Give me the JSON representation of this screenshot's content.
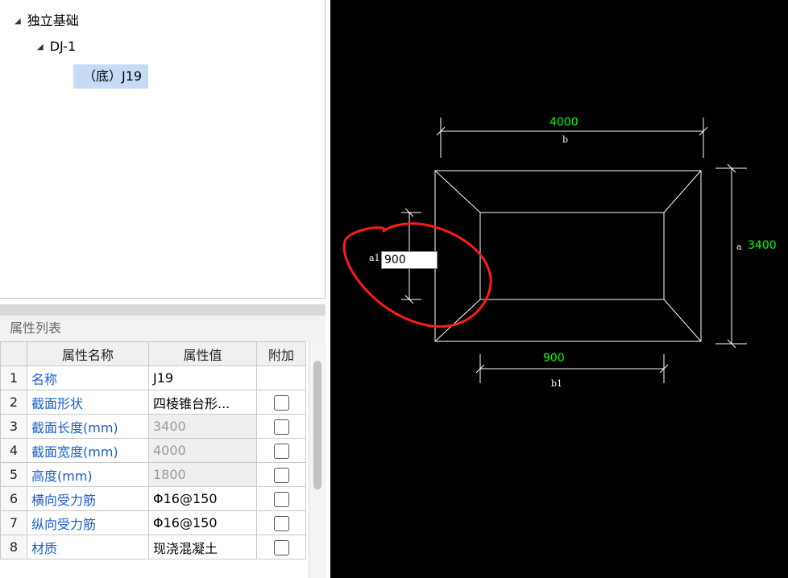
{
  "tree": {
    "root": "独立基础",
    "child": "DJ-1",
    "leaf": "（底）J19"
  },
  "properties": {
    "title": "属性列表",
    "headers": [
      "",
      "属性名称",
      "属性值",
      "附加"
    ],
    "rows": [
      {
        "num": "1",
        "name": "名称",
        "value": "J19",
        "disabled": false,
        "checkbox": false
      },
      {
        "num": "2",
        "name": "截面形状",
        "value": "四棱锥台形...",
        "disabled": false,
        "checkbox": true
      },
      {
        "num": "3",
        "name": "截面长度(mm)",
        "value": "3400",
        "disabled": true,
        "checkbox": true
      },
      {
        "num": "4",
        "name": "截面宽度(mm)",
        "value": "4000",
        "disabled": true,
        "checkbox": true
      },
      {
        "num": "5",
        "name": "高度(mm)",
        "value": "1800",
        "disabled": true,
        "checkbox": true
      },
      {
        "num": "6",
        "name": "横向受力筋",
        "value": "Φ16@150",
        "disabled": false,
        "checkbox": true
      },
      {
        "num": "7",
        "name": "纵向受力筋",
        "value": "Φ16@150",
        "disabled": false,
        "checkbox": true
      },
      {
        "num": "8",
        "name": "材质",
        "value": "现浇混凝土",
        "disabled": false,
        "checkbox": true
      }
    ]
  },
  "cad": {
    "dim_b_value": "4000",
    "dim_b_label": "b",
    "dim_a_value": "3400",
    "dim_a_label": "a",
    "dim_b1_value": "900",
    "dim_b1_label": "b1",
    "dim_a1_label": "a1",
    "a1_input_value": "900",
    "colors": {
      "background": "#000000",
      "dimension_value": "#00ff00",
      "lines": "#ffffff",
      "annotation": "#ff0000"
    }
  }
}
